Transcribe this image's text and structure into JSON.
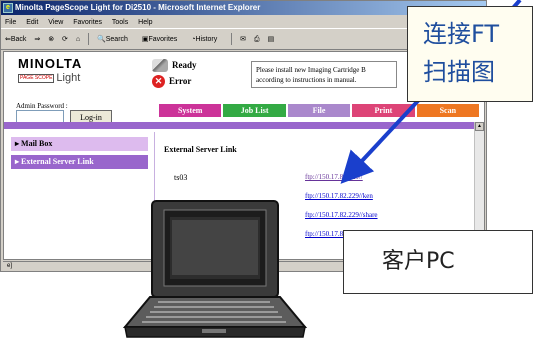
{
  "window": {
    "title": "Minolta PageScope Light for Di2510 - Microsoft Internet Explorer",
    "menu": [
      "File",
      "Edit",
      "View",
      "Favorites",
      "Tools",
      "Help"
    ],
    "toolbar": {
      "back": "⇐Back",
      "forward": "⇒",
      "search": "Search",
      "favorites": "Favorites",
      "history": "History"
    }
  },
  "header": {
    "brand": "MINOLTA",
    "product": "Light",
    "product_badge": "PAGE SCOPE",
    "status_ready": "Ready",
    "status_error": "Error",
    "message": "Please install new Imaging Cartridge B according to instructions in manual.",
    "admin_label": "Admin Password :",
    "login_label": "Log-in"
  },
  "tabs": [
    {
      "label": "System",
      "color": "#cc3399"
    },
    {
      "label": "Job List",
      "color": "#33aa44"
    },
    {
      "label": "File",
      "color": "#aa88cc"
    },
    {
      "label": "Print",
      "color": "#dd4477"
    },
    {
      "label": "Scan",
      "color": "#ee7722"
    }
  ],
  "sidebar": {
    "items": [
      {
        "label": "Mail Box"
      },
      {
        "label": "External Server Link"
      }
    ]
  },
  "main": {
    "title": "External Server Link",
    "server_name": "ts03",
    "links": [
      "ftp://150.17.82.229//",
      "ftp://150.17.82.229//ken",
      "ftp://150.17.82.229//share",
      "ftp://150.17.82.229//sharp"
    ]
  },
  "statusbar": {
    "icon": "ie-page-icon"
  },
  "overlays": {
    "callout_top_line1": "连接FT",
    "callout_top_line2": "扫描图",
    "callout_pc": "客户PC",
    "arrow_color": "#1a3fcc"
  }
}
